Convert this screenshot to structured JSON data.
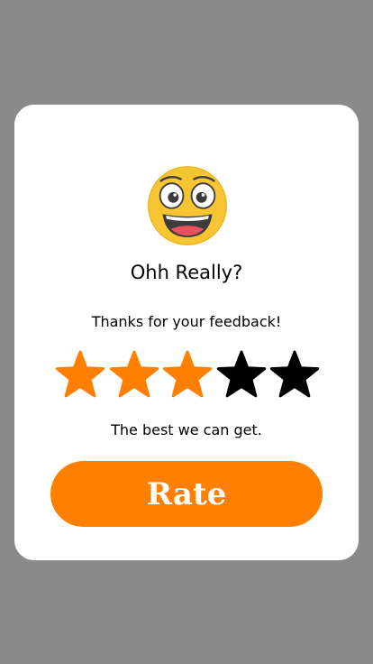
{
  "dialog": {
    "emoji": "grinning-face-icon",
    "title": "Ohh Really?",
    "subtitle": "Thanks for your feedback!",
    "rating": {
      "value": 3,
      "max": 5,
      "filled_color": "#ff8000",
      "empty_color": "#000000"
    },
    "caption": "The best we can get.",
    "rate_label": "Rate"
  },
  "colors": {
    "overlay": "#8a8a8a",
    "card": "#ffffff",
    "accent": "#ff8000"
  }
}
